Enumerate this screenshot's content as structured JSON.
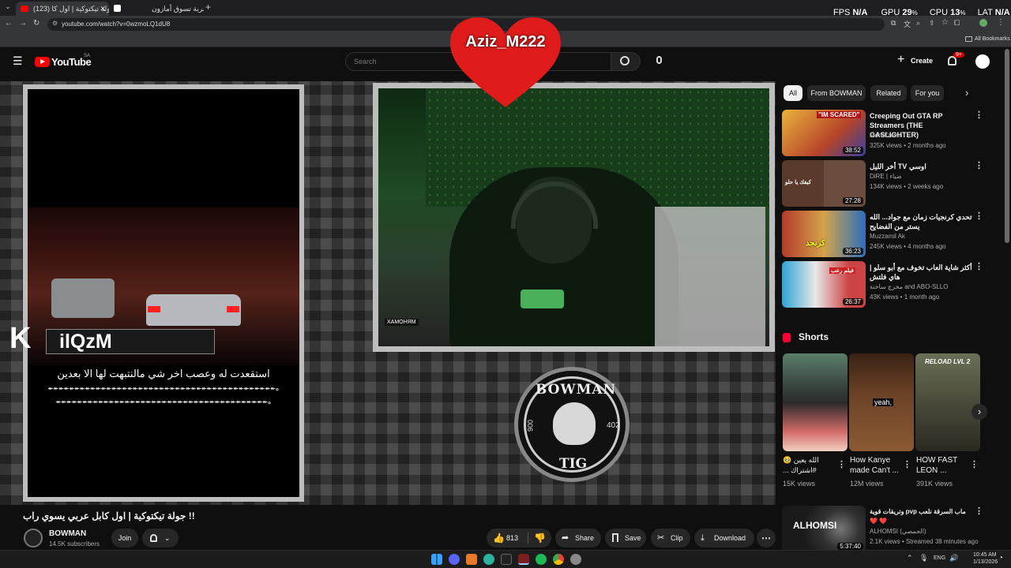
{
  "browser": {
    "tabs": [
      {
        "label": "(123) جولة تيكتوكية | اول كا...",
        "active": true
      },
      {
        "label": "عربة تسوق أمازون",
        "active": false
      }
    ],
    "url": "youtube.com/watch?v=0wzmoLQ1dU8",
    "bookmarks_label": "All Bookmarks"
  },
  "overlay": {
    "fps_label": "FPS",
    "fps_value": "N/A",
    "gpu_label": "GPU",
    "gpu_value": "29",
    "cpu_label": "CPU",
    "cpu_value": "13",
    "lat_label": "LAT",
    "lat_value": "N/A",
    "percent": "%"
  },
  "youtube": {
    "logo_text": "YouTube",
    "country": "SA",
    "search_placeholder": "Search",
    "create_label": "Create",
    "notif_badge": "9+"
  },
  "stream": {
    "heart_name": "Aziz_M222",
    "left_name": "ilQzM",
    "left_k": "K",
    "caption_line1": "استقعدت له وعصب اخر شي مالنتبهت لها الا بعدين",
    "caption_line2": "ه↞↞↞↞↞↞↞↞↞↞↞↞↞↞↞↞↞↞↞↞↞↞↞↞↞↞↞↞↞↞↞↞↞↞↞↞↞↞↞↞↞↞↞",
    "caption_line3": "ه↞↞↞↞↞↞↞↞↞↞↞↞↞↞↞↞↞↞↞↞↞↞↞↞↞↞↞↞↞↞↞↞↞↞↞↞↞↞↞↞",
    "logo_top": "BOWMAN",
    "logo_bottom": "TIG",
    "logo_left_num": "006",
    "logo_right_num": "402",
    "mic_label": "ХАМОНЯМ"
  },
  "video": {
    "title": "!! جولة تيكتوكية | اول كابل عربي يسوي راب",
    "channel": "BOWMAN",
    "subscribers": "14.5K subscribers",
    "join_label": "Join",
    "likes": "813",
    "share_label": "Share",
    "save_label": "Save",
    "clip_label": "Clip",
    "download_label": "Download"
  },
  "chips": [
    "All",
    "From BOWMAN",
    "Related",
    "For you"
  ],
  "recommendations": [
    {
      "title": "Creeping Out GTA RP Streamers (THE GASLIGHTER)",
      "channel": "MoreCrown",
      "meta": "325K views • 2 months ago",
      "duration": "38:52",
      "thumb_text": "\"IM SCARED\""
    },
    {
      "title": "اوسي TV أخر الليل",
      "channel": "DiRE | ضياء",
      "meta": "134K views • 2 weeks ago",
      "duration": "27:28",
      "thumb_text": "كيفك يا حلو"
    },
    {
      "title": "تحدي كرنجيات زمان مع جواد... الله يستر من الفضايح",
      "channel": "Muzzamil Ak",
      "meta": "245K views • 4 months ago",
      "duration": "36:23",
      "thumb_text": "كرنجد"
    },
    {
      "title": "أكثر شاية العاب تخوف مع أبو سلو | هاي فلتش",
      "channel": "مخرج ساخنة and ABO-SLLO",
      "meta": "43K views • 1 month ago",
      "duration": "26:37",
      "thumb_text": "فيلم رعب"
    }
  ],
  "shorts_heading": "Shorts",
  "shorts": [
    {
      "title": "الله يعين 🥹 #اشتراك ...",
      "views": "15K views"
    },
    {
      "title": "How Kanye made Can't ...",
      "views": "12M views",
      "thumb_text": "yeah,"
    },
    {
      "title": "HOW FAST LEON ...",
      "views": "391K views",
      "thumb_text": "RELOAD LVL 2"
    }
  ],
  "live_rec": {
    "title": "ماب السرقة نلعب pvp وتريقات قوية❤️ ❤️",
    "channel": "ALHOMSI (الحمصي)",
    "meta": "2.1K views • Streamed 38 minutes ago",
    "duration": "5:37:40",
    "thumb_text": "ALHOMSI"
  },
  "taskbar": {
    "lang": "ENG",
    "time": "10:45 AM",
    "date": "1/13/2026"
  },
  "colors": {
    "red": "#ff0000",
    "heart": "#e01b1b",
    "camo_green": "#2f6b34"
  }
}
